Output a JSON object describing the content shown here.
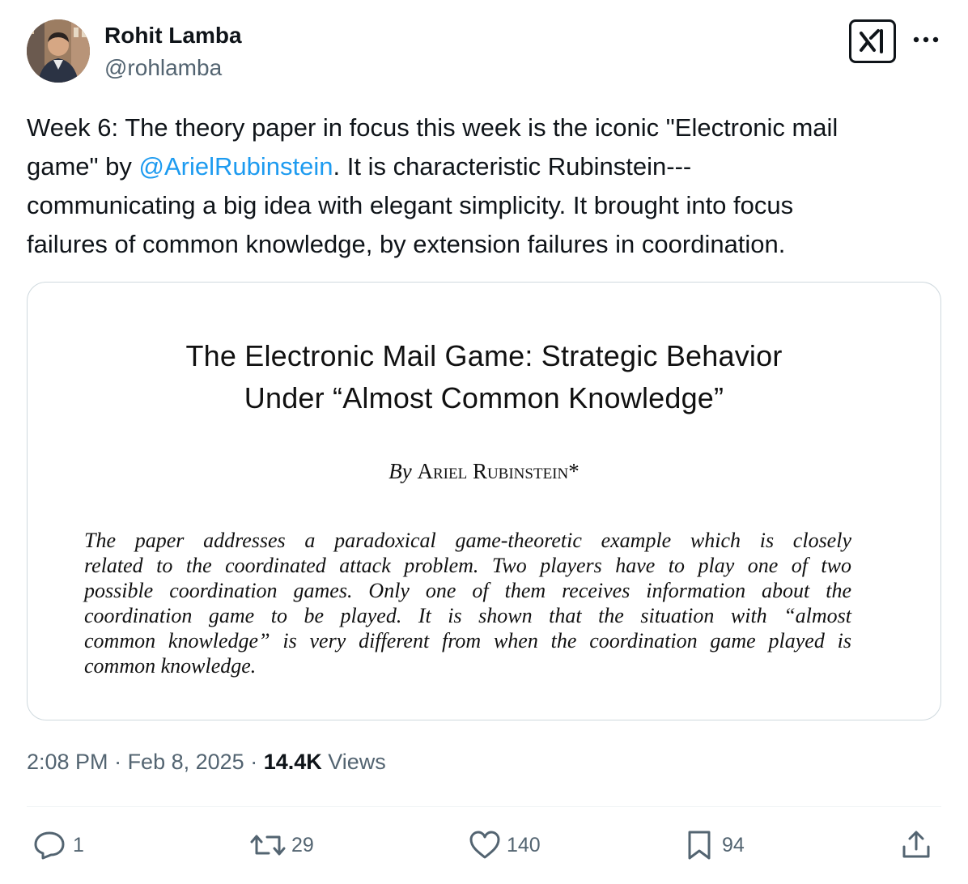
{
  "author": {
    "name": "Rohit Lamba",
    "handle": "@rohlamba",
    "avatar_icon": "avatar-photo"
  },
  "header_icons": {
    "grok": "grok-icon",
    "more": "more-options-icon"
  },
  "tweet": {
    "lines": [
      {
        "before": "Week 6: The theory paper in focus this week is the iconic \"Electronic mail",
        "mention": "",
        "after": ""
      },
      {
        "before": "game\" by ",
        "mention": "@ArielRubinstein",
        "after": ". It is characteristic Rubinstein---"
      },
      {
        "before": "communicating a big idea with elegant simplicity. It brought into focus",
        "mention": "",
        "after": ""
      },
      {
        "before": "failures of common knowledge, by extension failures in coordination.",
        "mention": "",
        "after": ""
      }
    ],
    "mention_color": "#1d9bf0"
  },
  "media": {
    "title_lines": [
      "The Electronic Mail Game: Strategic Behavior",
      "Under “Almost Common Knowledge”"
    ],
    "author_by": "By",
    "author_name": "Ariel Rubinstein*",
    "abstract_lines": [
      "The paper addresses a paradoxical game-theoretic example which is closely",
      "related to the coordinated attack problem. Two players have to play one of two",
      "possible coordination games. Only one of them receives information about the",
      "coordination game to be played. It is shown that the situation with “almost",
      "common knowledge” is very different from when the coordination game played is",
      "common knowledge."
    ]
  },
  "meta": {
    "time": "2:08 PM",
    "sep1": " · ",
    "date": "Feb 8, 2025",
    "sep2": " · ",
    "views_count": "14.4K",
    "views_label": " Views"
  },
  "actions": {
    "replies": "1",
    "reposts": "29",
    "likes": "140",
    "bookmarks": "94",
    "colors": {
      "icon": "#536471"
    }
  }
}
